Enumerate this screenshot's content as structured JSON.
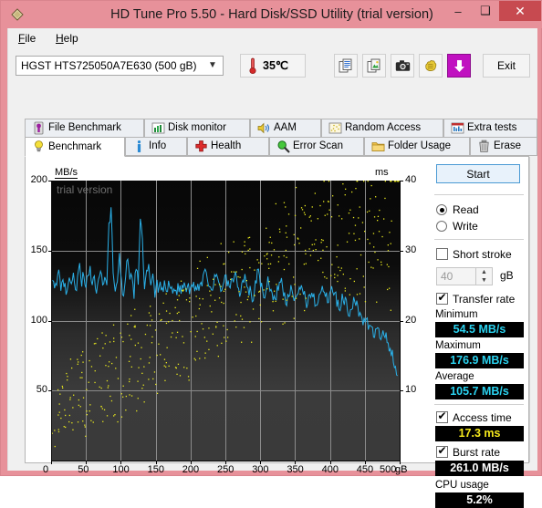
{
  "window": {
    "title": "HD Tune Pro 5.50 - Hard Disk/SSD Utility (trial version)",
    "icon": "app-diamond-icon",
    "minimize": "–",
    "maximize": "❑",
    "close": "✕",
    "titlebar_color": "#e7919a",
    "close_color": "#c74a50"
  },
  "menu": {
    "items": [
      {
        "label": "File",
        "accel": "F"
      },
      {
        "label": "Help",
        "accel": "H"
      }
    ]
  },
  "toolbar": {
    "drive": {
      "selected": "HGST HTS725050A7E630 (500 gB)",
      "arrow": "▼"
    },
    "temperature": "35℃",
    "thermometer_icon": "thermometer-icon",
    "buttons": [
      {
        "name": "copy-to-clipboard-button",
        "icon": "copy-documents-icon"
      },
      {
        "name": "copy-image-button",
        "icon": "copy-image-icon"
      },
      {
        "name": "screenshot-button",
        "icon": "camera-icon"
      },
      {
        "name": "hand-button",
        "icon": "hand-icon"
      },
      {
        "name": "save-button",
        "icon": "download-arrow-icon"
      }
    ],
    "exit_label": "Exit"
  },
  "tabs": {
    "row1": [
      {
        "label": "File Benchmark",
        "icon": "file-benchmark-icon",
        "active": false
      },
      {
        "label": "Disk monitor",
        "icon": "disk-monitor-icon",
        "active": false
      },
      {
        "label": "AAM",
        "icon": "speaker-icon",
        "active": false
      },
      {
        "label": "Random Access",
        "icon": "random-access-icon",
        "active": false
      },
      {
        "label": "Extra tests",
        "icon": "extra-tests-icon",
        "active": false
      }
    ],
    "row2": [
      {
        "label": "Benchmark",
        "icon": "lightbulb-icon",
        "active": true
      },
      {
        "label": "Info",
        "icon": "info-icon",
        "active": false
      },
      {
        "label": "Health",
        "icon": "health-cross-icon",
        "active": false
      },
      {
        "label": "Error Scan",
        "icon": "magnifier-icon",
        "active": false
      },
      {
        "label": "Folder Usage",
        "icon": "folder-icon",
        "active": false
      },
      {
        "label": "Erase",
        "icon": "trash-icon",
        "active": false
      }
    ]
  },
  "results": {
    "start_label": "Start",
    "mode": {
      "read_label": "Read",
      "write_label": "Write",
      "selected": "Read"
    },
    "short_stroke": {
      "label": "Short stroke",
      "checked": false,
      "value": "40",
      "unit": "gB",
      "spin_up": "▲",
      "spin_down": "▼"
    },
    "transfer_rate": {
      "label": "Transfer rate",
      "checked": true,
      "minimum_label": "Minimum",
      "minimum_value": "54.5 MB/s",
      "maximum_label": "Maximum",
      "maximum_value": "176.9 MB/s",
      "average_label": "Average",
      "average_value": "105.7 MB/s"
    },
    "access_time": {
      "label": "Access time",
      "checked": true,
      "value": "17.3 ms"
    },
    "burst_rate": {
      "label": "Burst rate",
      "checked": true,
      "value": "261.0 MB/s"
    },
    "cpu_usage": {
      "label": "CPU usage",
      "value": "5.2%"
    }
  },
  "chart_data": {
    "type": "line",
    "title": "",
    "watermark": "trial version",
    "ylabel": "MB/s",
    "y2label": "ms",
    "xlabel": "gB",
    "xlim": [
      0,
      500
    ],
    "ylim": [
      0,
      200
    ],
    "y2lim": [
      0,
      40
    ],
    "grid": true,
    "legend": "none",
    "xticks": [
      0,
      50,
      100,
      150,
      200,
      250,
      300,
      350,
      400,
      450,
      500
    ],
    "xtick_labels": [
      "0",
      "50",
      "100",
      "150",
      "200",
      "250",
      "300",
      "350",
      "400",
      "450",
      "500"
    ],
    "x_unit_suffix": "gB",
    "yticks": [
      50,
      100,
      150,
      200
    ],
    "ytick_labels": [
      "50",
      "100",
      "150",
      "200"
    ],
    "y2ticks": [
      10,
      20,
      30,
      40
    ],
    "y2tick_labels": [
      "10",
      "20",
      "30",
      "40"
    ],
    "colors": {
      "transfer_rate": "#2ab0e8",
      "access_time": "#e8e81e",
      "grid": "#8b8b8b",
      "background_top": "#070707",
      "background_bottom": "#3a3a3a"
    },
    "series": [
      {
        "name": "Transfer rate",
        "axis": "left",
        "unit": "MB/s",
        "color": "#2ab0e8",
        "x": [
          2,
          5,
          8,
          11,
          14,
          17,
          20,
          23,
          26,
          29,
          32,
          35,
          38,
          41,
          44,
          47,
          50,
          53,
          56,
          59,
          62,
          65,
          68,
          71,
          74,
          77,
          80,
          83,
          86,
          89,
          92,
          95,
          98,
          101,
          104,
          107,
          110,
          113,
          116,
          119,
          122,
          125,
          128,
          131,
          134,
          137,
          140,
          143,
          146,
          149,
          152,
          155,
          158,
          161,
          164,
          167,
          170,
          173,
          176,
          179,
          182,
          185,
          188,
          191,
          194,
          197,
          200,
          203,
          206,
          209,
          212,
          215,
          218,
          221,
          224,
          227,
          230,
          233,
          236,
          239,
          242,
          245,
          248,
          251,
          254,
          257,
          260,
          263,
          266,
          269,
          272,
          275,
          278,
          281,
          284,
          287,
          290,
          293,
          296,
          299,
          302,
          305,
          308,
          311,
          314,
          317,
          320,
          323,
          326,
          329,
          332,
          335,
          338,
          341,
          344,
          347,
          350,
          353,
          356,
          359,
          362,
          365,
          368,
          371,
          374,
          377,
          380,
          383,
          386,
          389,
          392,
          395,
          398,
          401,
          404,
          407,
          410,
          413,
          416,
          419,
          422,
          425,
          428,
          431,
          434,
          437,
          440,
          443,
          446,
          449,
          452,
          455,
          458,
          461,
          464,
          467,
          470,
          473,
          476,
          479,
          482,
          485,
          488,
          491,
          494,
          497
        ],
        "y": [
          132,
          120,
          126,
          134,
          124,
          131,
          127,
          118,
          133,
          128,
          136,
          121,
          130,
          138,
          125,
          134,
          122,
          131,
          140,
          126,
          133,
          120,
          129,
          137,
          124,
          132,
          128,
          168,
          181,
          135,
          123,
          130,
          145,
          127,
          120,
          134,
          142,
          126,
          131,
          119,
          138,
          128,
          175,
          160,
          122,
          133,
          140,
          124,
          130,
          118,
          127,
          122,
          123,
          124,
          124,
          123,
          124,
          123,
          124,
          123,
          124,
          123,
          124,
          124,
          123,
          124,
          123,
          124,
          123,
          124,
          124,
          127,
          131,
          136,
          132,
          127,
          123,
          126,
          131,
          128,
          124,
          122,
          126,
          130,
          126,
          123,
          127,
          132,
          128,
          124,
          120,
          126,
          130,
          125,
          121,
          118,
          116,
          128,
          134,
          130,
          124,
          118,
          122,
          128,
          124,
          119,
          115,
          118,
          124,
          128,
          124,
          118,
          113,
          117,
          122,
          118,
          113,
          117,
          122,
          126,
          121,
          116,
          112,
          116,
          121,
          117,
          112,
          116,
          121,
          126,
          122,
          117,
          113,
          118,
          123,
          118,
          113,
          109,
          113,
          118,
          114,
          110,
          106,
          110,
          116,
          112,
          107,
          103,
          99,
          103,
          98,
          95,
          99,
          94,
          90,
          95,
          91,
          87,
          92,
          88,
          84,
          80,
          76,
          72,
          68,
          64
        ]
      },
      {
        "name": "Access time",
        "axis": "right",
        "unit": "ms",
        "color": "#e8e81e",
        "description": "scattered point cloud, rising trend from ~2 ms near 0 gB to ~25 ms near 500 gB",
        "x": [
          3,
          6,
          9,
          12,
          15,
          18,
          21,
          24,
          27,
          30,
          33,
          36,
          39,
          42,
          45,
          48,
          51,
          54,
          57,
          60,
          63,
          66,
          69,
          72,
          75,
          78,
          81,
          84,
          87,
          90,
          93,
          96,
          99,
          102,
          105,
          108,
          111,
          114,
          117,
          120,
          123,
          126,
          129,
          132,
          135,
          138,
          141,
          144,
          147,
          150,
          153,
          156,
          159,
          162,
          165,
          168,
          171,
          174,
          177,
          180,
          183,
          186,
          189,
          192,
          195,
          198,
          201,
          204,
          207,
          210,
          213,
          216,
          219,
          222,
          225,
          228,
          231,
          234,
          237,
          240,
          243,
          246,
          249,
          252,
          255,
          258,
          261,
          264,
          267,
          270,
          273,
          276,
          279,
          282,
          285,
          288,
          291,
          294,
          297,
          300,
          303,
          306,
          309,
          312,
          315,
          318,
          321,
          324,
          327,
          330,
          333,
          336,
          339,
          342,
          345,
          348,
          351,
          354,
          357,
          360,
          363,
          366,
          369,
          372,
          375,
          378,
          381,
          384,
          387,
          390,
          393,
          396,
          399,
          402,
          405,
          408,
          411,
          414,
          417,
          420,
          423,
          426,
          429,
          432,
          435,
          438,
          441,
          444,
          447,
          450,
          453,
          456,
          459,
          462,
          465,
          468,
          471,
          474,
          477,
          480,
          483,
          486,
          489,
          492,
          495,
          498
        ],
        "y": [
          3.1,
          7.2,
          5.4,
          9.8,
          4.1,
          11.2,
          6.3,
          13.5,
          8.7,
          5.2,
          14.1,
          9.3,
          6.8,
          12.4,
          4.9,
          15.2,
          10.1,
          7.6,
          13.2,
          5.8,
          16.4,
          11.3,
          8.2,
          14.8,
          6.1,
          17.3,
          12.2,
          9.4,
          15.6,
          7.3,
          18.2,
          13.1,
          10.2,
          16.4,
          8.1,
          19.1,
          14.2,
          11.1,
          17.2,
          9.2,
          20.3,
          15.1,
          12.3,
          18.1,
          10.4,
          21.2,
          16.2,
          13.2,
          19.3,
          11.2,
          22.1,
          17.1,
          14.1,
          20.2,
          12.1,
          23.2,
          18.2,
          15.2,
          21.1,
          13.2,
          24.1,
          19.1,
          16.1,
          22.2,
          14.2,
          25.2,
          20.1,
          17.2,
          23.1,
          15.1,
          26.1,
          21.2,
          18.1,
          24.2,
          16.2,
          27.2,
          22.1,
          19.2,
          25.1,
          17.1,
          28.1,
          23.2,
          20.2,
          26.2,
          18.2,
          29.2,
          24.1,
          21.1,
          27.1,
          19.1,
          30.1,
          25.2,
          22.2,
          28.2,
          20.2,
          31.2,
          26.1,
          23.1,
          29.1,
          21.1,
          32.1,
          27.2,
          24.2,
          30.2,
          22.2,
          33.2,
          28.1,
          25.1,
          31.1,
          23.1,
          34.1,
          29.2,
          26.2,
          32.2,
          24.2,
          35.2,
          30.1,
          27.1,
          33.1,
          25.1,
          36.1,
          31.2,
          28.2,
          34.2,
          26.2,
          37.2,
          32.1,
          29.1,
          35.1,
          27.1,
          38.1,
          33.2,
          30.2,
          36.2,
          28.2,
          24.1,
          34.1,
          31.1,
          37.1,
          29.1,
          25.2,
          35.2,
          32.2,
          38.2,
          30.2,
          26.1,
          36.1,
          33.1,
          39.1,
          31.1,
          27.1,
          37.2,
          34.2,
          32.2,
          28.2,
          24.2,
          38.1,
          35.1,
          33.1,
          29.1,
          25.1,
          31.2
        ]
      }
    ]
  }
}
